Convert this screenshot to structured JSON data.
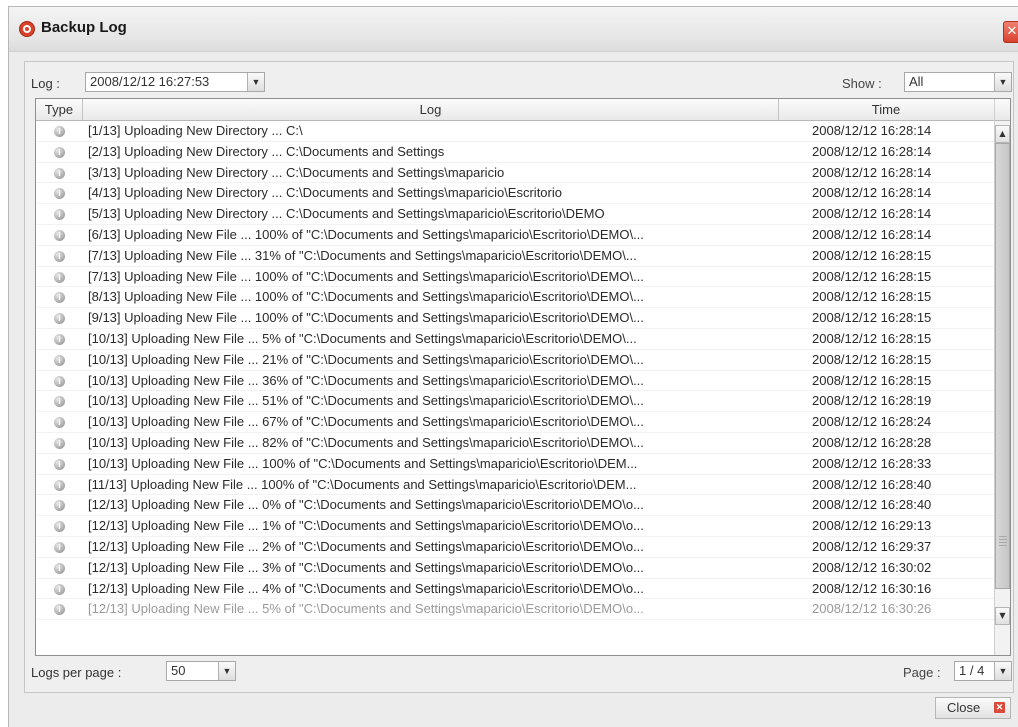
{
  "window": {
    "title": "Backup Log",
    "close_glyph": "✕"
  },
  "filter": {
    "log_label": "Log :",
    "log_value": "2008/12/12 16:27:53",
    "show_label": "Show :",
    "show_value": "All"
  },
  "table": {
    "columns": {
      "type": "Type",
      "log": "Log",
      "time": "Time"
    },
    "rows": [
      {
        "type_icon": "info-icon",
        "log": "[1/13] Uploading New Directory ... C:\\",
        "time": "2008/12/12 16:28:14"
      },
      {
        "type_icon": "info-icon",
        "log": "[2/13] Uploading New Directory ... C:\\Documents and Settings",
        "time": "2008/12/12 16:28:14"
      },
      {
        "type_icon": "info-icon",
        "log": "[3/13] Uploading New Directory ... C:\\Documents and Settings\\maparicio",
        "time": "2008/12/12 16:28:14"
      },
      {
        "type_icon": "info-icon",
        "log": "[4/13] Uploading New Directory ... C:\\Documents and Settings\\maparicio\\Escritorio",
        "time": "2008/12/12 16:28:14"
      },
      {
        "type_icon": "info-icon",
        "log": "[5/13] Uploading New Directory ... C:\\Documents and Settings\\maparicio\\Escritorio\\DEMO",
        "time": "2008/12/12 16:28:14"
      },
      {
        "type_icon": "info-icon",
        "log": "[6/13] Uploading New File ... 100% of \"C:\\Documents and Settings\\maparicio\\Escritorio\\DEMO\\...",
        "time": "2008/12/12 16:28:14"
      },
      {
        "type_icon": "info-icon",
        "log": "[7/13] Uploading New File ... 31% of \"C:\\Documents and Settings\\maparicio\\Escritorio\\DEMO\\...",
        "time": "2008/12/12 16:28:15"
      },
      {
        "type_icon": "info-icon",
        "log": "[7/13] Uploading New File ... 100% of \"C:\\Documents and Settings\\maparicio\\Escritorio\\DEMO\\...",
        "time": "2008/12/12 16:28:15"
      },
      {
        "type_icon": "info-icon",
        "log": "[8/13] Uploading New File ... 100% of \"C:\\Documents and Settings\\maparicio\\Escritorio\\DEMO\\...",
        "time": "2008/12/12 16:28:15"
      },
      {
        "type_icon": "info-icon",
        "log": "[9/13] Uploading New File ... 100% of \"C:\\Documents and Settings\\maparicio\\Escritorio\\DEMO\\...",
        "time": "2008/12/12 16:28:15"
      },
      {
        "type_icon": "info-icon",
        "log": "[10/13] Uploading New File ... 5% of \"C:\\Documents and Settings\\maparicio\\Escritorio\\DEMO\\...",
        "time": "2008/12/12 16:28:15"
      },
      {
        "type_icon": "info-icon",
        "log": "[10/13] Uploading New File ... 21% of \"C:\\Documents and Settings\\maparicio\\Escritorio\\DEMO\\...",
        "time": "2008/12/12 16:28:15"
      },
      {
        "type_icon": "info-icon",
        "log": "[10/13] Uploading New File ... 36% of \"C:\\Documents and Settings\\maparicio\\Escritorio\\DEMO\\...",
        "time": "2008/12/12 16:28:15"
      },
      {
        "type_icon": "info-icon",
        "log": "[10/13] Uploading New File ... 51% of \"C:\\Documents and Settings\\maparicio\\Escritorio\\DEMO\\...",
        "time": "2008/12/12 16:28:19"
      },
      {
        "type_icon": "info-icon",
        "log": "[10/13] Uploading New File ... 67% of \"C:\\Documents and Settings\\maparicio\\Escritorio\\DEMO\\...",
        "time": "2008/12/12 16:28:24"
      },
      {
        "type_icon": "info-icon",
        "log": "[10/13] Uploading New File ... 82% of \"C:\\Documents and Settings\\maparicio\\Escritorio\\DEMO\\...",
        "time": "2008/12/12 16:28:28"
      },
      {
        "type_icon": "info-icon",
        "log": "[10/13] Uploading New File ... 100% of \"C:\\Documents and Settings\\maparicio\\Escritorio\\DEM...",
        "time": "2008/12/12 16:28:33"
      },
      {
        "type_icon": "info-icon",
        "log": "[11/13] Uploading New File ... 100% of \"C:\\Documents and Settings\\maparicio\\Escritorio\\DEM...",
        "time": "2008/12/12 16:28:40"
      },
      {
        "type_icon": "info-icon",
        "log": "[12/13] Uploading New File ... 0% of \"C:\\Documents and Settings\\maparicio\\Escritorio\\DEMO\\o...",
        "time": "2008/12/12 16:28:40"
      },
      {
        "type_icon": "info-icon",
        "log": "[12/13] Uploading New File ... 1% of \"C:\\Documents and Settings\\maparicio\\Escritorio\\DEMO\\o...",
        "time": "2008/12/12 16:29:13"
      },
      {
        "type_icon": "info-icon",
        "log": "[12/13] Uploading New File ... 2% of \"C:\\Documents and Settings\\maparicio\\Escritorio\\DEMO\\o...",
        "time": "2008/12/12 16:29:37"
      },
      {
        "type_icon": "info-icon",
        "log": "[12/13] Uploading New File ... 3% of \"C:\\Documents and Settings\\maparicio\\Escritorio\\DEMO\\o...",
        "time": "2008/12/12 16:30:02"
      },
      {
        "type_icon": "info-icon",
        "log": "[12/13] Uploading New File ... 4% of \"C:\\Documents and Settings\\maparicio\\Escritorio\\DEMO\\o...",
        "time": "2008/12/12 16:30:16"
      },
      {
        "type_icon": "info-icon",
        "log": "[12/13] Uploading New File ... 5% of \"C:\\Documents and Settings\\maparicio\\Escritorio\\DEMO\\o...",
        "time": "2008/12/12 16:30:26"
      }
    ]
  },
  "footer": {
    "per_page_label": "Logs per page :",
    "per_page_value": "50",
    "page_label": "Page :",
    "page_value": "1 / 4",
    "close_label": "Close"
  },
  "colors": {
    "accent_red": "#d9412b",
    "header_bg": "#e9e9e9"
  }
}
